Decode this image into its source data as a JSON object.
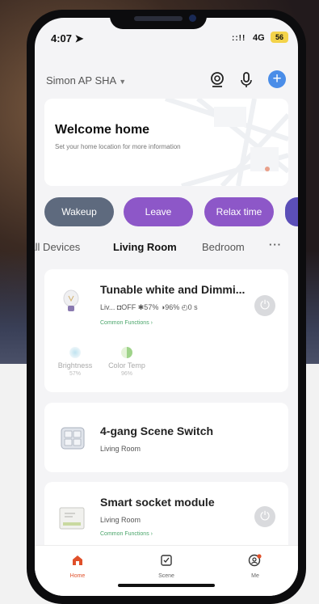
{
  "status_bar": {
    "time": "4:07",
    "signal": "::!!",
    "network": "4G",
    "battery": "56"
  },
  "header": {
    "home_name": "Simon AP SHA"
  },
  "welcome": {
    "title": "Welcome home",
    "subtitle": "Set your home location for more information"
  },
  "scenes": [
    {
      "label": "Wakeup"
    },
    {
      "label": "Leave"
    },
    {
      "label": "Relax time"
    },
    {
      "label": ""
    }
  ],
  "tabs": [
    {
      "label": "All Devices"
    },
    {
      "label": "Living Room"
    },
    {
      "label": "Bedroom"
    },
    {
      "label": "···"
    }
  ],
  "devices": [
    {
      "name": "Tunable white and Dimmi...",
      "status": "Liv... ◘OFF ✱57% ◑96% ◴0 s",
      "link": "Common Functions ›",
      "functions": [
        {
          "label": "Brightness",
          "value": "57%"
        },
        {
          "label": "Color Temp",
          "value": "96%"
        }
      ]
    },
    {
      "name": "4-gang Scene Switch",
      "room": "Living Room"
    },
    {
      "name": "Smart socket module",
      "room": "Living Room",
      "link": "Common Functions ›"
    }
  ],
  "nav": [
    {
      "label": "Home"
    },
    {
      "label": "Scene"
    },
    {
      "label": "Me"
    }
  ],
  "colors": {
    "accent": "#4a8de8",
    "scene_purple": "#8d57c8",
    "scene_gray": "#5e6a7e",
    "home_active": "#e0502a",
    "link_green": "#4aa56a"
  }
}
